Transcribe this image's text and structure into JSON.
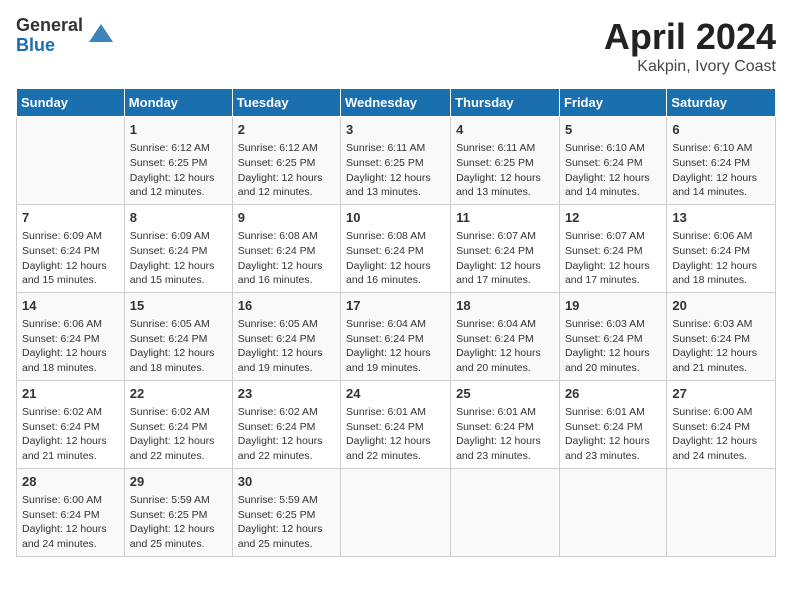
{
  "logo": {
    "general": "General",
    "blue": "Blue"
  },
  "title": "April 2024",
  "subtitle": "Kakpin, Ivory Coast",
  "headers": [
    "Sunday",
    "Monday",
    "Tuesday",
    "Wednesday",
    "Thursday",
    "Friday",
    "Saturday"
  ],
  "weeks": [
    [
      {
        "day": "",
        "info": ""
      },
      {
        "day": "1",
        "info": "Sunrise: 6:12 AM\nSunset: 6:25 PM\nDaylight: 12 hours\nand 12 minutes."
      },
      {
        "day": "2",
        "info": "Sunrise: 6:12 AM\nSunset: 6:25 PM\nDaylight: 12 hours\nand 12 minutes."
      },
      {
        "day": "3",
        "info": "Sunrise: 6:11 AM\nSunset: 6:25 PM\nDaylight: 12 hours\nand 13 minutes."
      },
      {
        "day": "4",
        "info": "Sunrise: 6:11 AM\nSunset: 6:25 PM\nDaylight: 12 hours\nand 13 minutes."
      },
      {
        "day": "5",
        "info": "Sunrise: 6:10 AM\nSunset: 6:24 PM\nDaylight: 12 hours\nand 14 minutes."
      },
      {
        "day": "6",
        "info": "Sunrise: 6:10 AM\nSunset: 6:24 PM\nDaylight: 12 hours\nand 14 minutes."
      }
    ],
    [
      {
        "day": "7",
        "info": "Sunrise: 6:09 AM\nSunset: 6:24 PM\nDaylight: 12 hours\nand 15 minutes."
      },
      {
        "day": "8",
        "info": "Sunrise: 6:09 AM\nSunset: 6:24 PM\nDaylight: 12 hours\nand 15 minutes."
      },
      {
        "day": "9",
        "info": "Sunrise: 6:08 AM\nSunset: 6:24 PM\nDaylight: 12 hours\nand 16 minutes."
      },
      {
        "day": "10",
        "info": "Sunrise: 6:08 AM\nSunset: 6:24 PM\nDaylight: 12 hours\nand 16 minutes."
      },
      {
        "day": "11",
        "info": "Sunrise: 6:07 AM\nSunset: 6:24 PM\nDaylight: 12 hours\nand 17 minutes."
      },
      {
        "day": "12",
        "info": "Sunrise: 6:07 AM\nSunset: 6:24 PM\nDaylight: 12 hours\nand 17 minutes."
      },
      {
        "day": "13",
        "info": "Sunrise: 6:06 AM\nSunset: 6:24 PM\nDaylight: 12 hours\nand 18 minutes."
      }
    ],
    [
      {
        "day": "14",
        "info": "Sunrise: 6:06 AM\nSunset: 6:24 PM\nDaylight: 12 hours\nand 18 minutes."
      },
      {
        "day": "15",
        "info": "Sunrise: 6:05 AM\nSunset: 6:24 PM\nDaylight: 12 hours\nand 18 minutes."
      },
      {
        "day": "16",
        "info": "Sunrise: 6:05 AM\nSunset: 6:24 PM\nDaylight: 12 hours\nand 19 minutes."
      },
      {
        "day": "17",
        "info": "Sunrise: 6:04 AM\nSunset: 6:24 PM\nDaylight: 12 hours\nand 19 minutes."
      },
      {
        "day": "18",
        "info": "Sunrise: 6:04 AM\nSunset: 6:24 PM\nDaylight: 12 hours\nand 20 minutes."
      },
      {
        "day": "19",
        "info": "Sunrise: 6:03 AM\nSunset: 6:24 PM\nDaylight: 12 hours\nand 20 minutes."
      },
      {
        "day": "20",
        "info": "Sunrise: 6:03 AM\nSunset: 6:24 PM\nDaylight: 12 hours\nand 21 minutes."
      }
    ],
    [
      {
        "day": "21",
        "info": "Sunrise: 6:02 AM\nSunset: 6:24 PM\nDaylight: 12 hours\nand 21 minutes."
      },
      {
        "day": "22",
        "info": "Sunrise: 6:02 AM\nSunset: 6:24 PM\nDaylight: 12 hours\nand 22 minutes."
      },
      {
        "day": "23",
        "info": "Sunrise: 6:02 AM\nSunset: 6:24 PM\nDaylight: 12 hours\nand 22 minutes."
      },
      {
        "day": "24",
        "info": "Sunrise: 6:01 AM\nSunset: 6:24 PM\nDaylight: 12 hours\nand 22 minutes."
      },
      {
        "day": "25",
        "info": "Sunrise: 6:01 AM\nSunset: 6:24 PM\nDaylight: 12 hours\nand 23 minutes."
      },
      {
        "day": "26",
        "info": "Sunrise: 6:01 AM\nSunset: 6:24 PM\nDaylight: 12 hours\nand 23 minutes."
      },
      {
        "day": "27",
        "info": "Sunrise: 6:00 AM\nSunset: 6:24 PM\nDaylight: 12 hours\nand 24 minutes."
      }
    ],
    [
      {
        "day": "28",
        "info": "Sunrise: 6:00 AM\nSunset: 6:24 PM\nDaylight: 12 hours\nand 24 minutes."
      },
      {
        "day": "29",
        "info": "Sunrise: 5:59 AM\nSunset: 6:25 PM\nDaylight: 12 hours\nand 25 minutes."
      },
      {
        "day": "30",
        "info": "Sunrise: 5:59 AM\nSunset: 6:25 PM\nDaylight: 12 hours\nand 25 minutes."
      },
      {
        "day": "",
        "info": ""
      },
      {
        "day": "",
        "info": ""
      },
      {
        "day": "",
        "info": ""
      },
      {
        "day": "",
        "info": ""
      }
    ]
  ]
}
